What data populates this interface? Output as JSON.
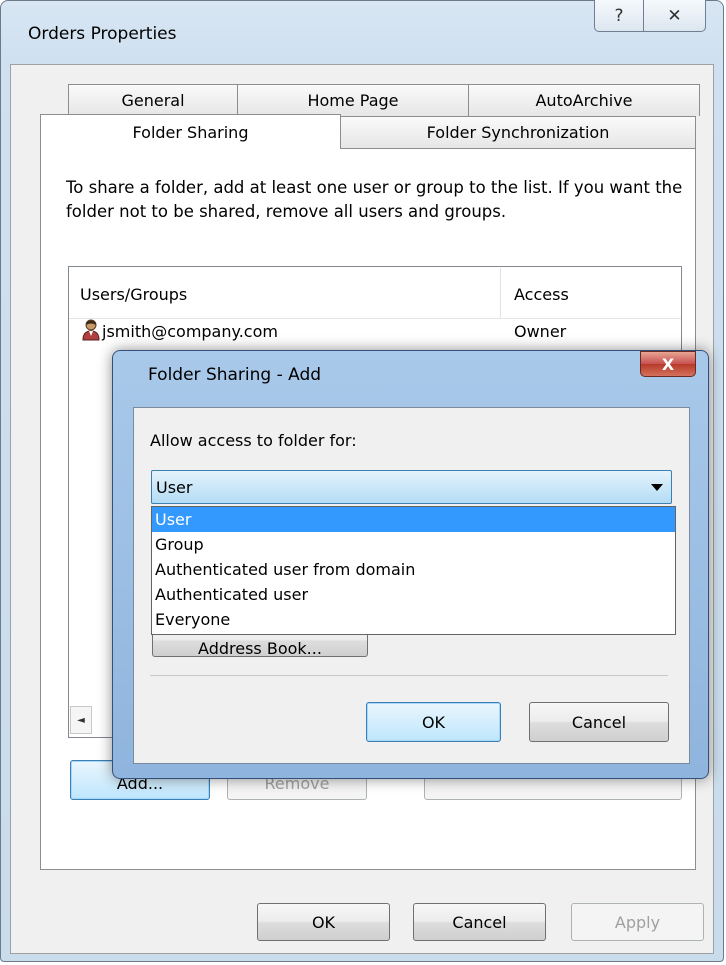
{
  "window": {
    "title": "Orders Properties",
    "help_glyph": "?",
    "close_glyph": "✕"
  },
  "tabs": {
    "row1": [
      "General",
      "Home Page",
      "AutoArchive"
    ],
    "row2": [
      "Folder Sharing",
      "Folder Synchronization"
    ],
    "active": "Folder Sharing"
  },
  "sharing": {
    "description": "To share a folder, add at least one user or group to the list. If you want the folder not to be shared, remove all users and groups.",
    "list": {
      "columns": [
        "Users/Groups",
        "Access"
      ],
      "rows": [
        {
          "user": "jsmith@company.com",
          "access": "Owner"
        }
      ]
    },
    "add_button": "Add...",
    "remove_button": "Remove"
  },
  "footer": {
    "ok": "OK",
    "cancel": "Cancel",
    "apply": "Apply"
  },
  "add_dialog": {
    "title": "Folder Sharing - Add",
    "close_glyph": "X",
    "label": "Allow access to folder for:",
    "combo_value": "User",
    "options": [
      "User",
      "Group",
      "Authenticated user from domain",
      "Authenticated user",
      "Everyone"
    ],
    "selected_option": "User",
    "address_book_button": "Address Book...",
    "ok": "OK",
    "cancel": "Cancel"
  },
  "colors": {
    "selection": "#3399ff",
    "dialog_frame": "#a9c9ea",
    "close_button": "#c75050"
  }
}
